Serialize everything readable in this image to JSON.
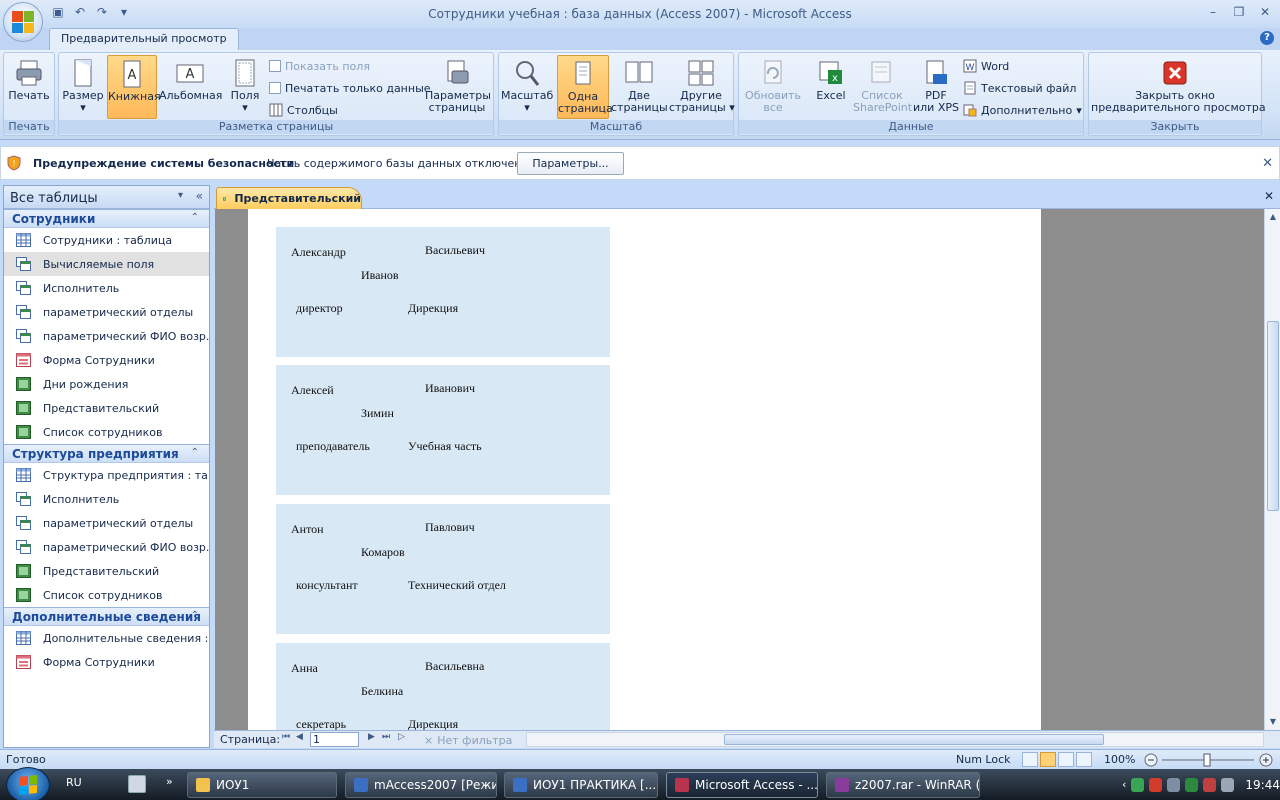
{
  "window": {
    "title": "Сотрудники учебная : база данных (Access 2007) - Microsoft Access"
  },
  "tabs": {
    "active": "Предварительный просмотр"
  },
  "ribbon": {
    "groups": {
      "print": "Печать",
      "page_layout": "Разметка страницы",
      "zoom": "Масштаб",
      "data": "Данные",
      "close": "Закрыть"
    },
    "print_label": "Печать",
    "size_label": "Размер",
    "portrait_label": "Книжная",
    "landscape_label": "Альбомная",
    "margins_label": "Поля",
    "show_margins": "Показать поля",
    "print_data_only": "Печатать только данные",
    "columns": "Столбцы",
    "page_setup_1": "Параметры",
    "page_setup_2": "страницы",
    "zoom_label": "Масштаб",
    "one_page_1": "Одна",
    "one_page_2": "страница",
    "two_pages_1": "Две",
    "two_pages_2": "страницы",
    "more_pages_1": "Другие",
    "more_pages_2": "страницы",
    "refresh_1": "Обновить",
    "refresh_2": "все",
    "excel": "Excel",
    "sharepoint_1": "Список",
    "sharepoint_2": "SharePoint",
    "pdf_1": "PDF",
    "pdf_2": "или XPS",
    "word": "Word",
    "text_file": "Текстовый файл",
    "more": "Дополнительно",
    "close_preview_1": "Закрыть окно",
    "close_preview_2": "предварительного просмотра"
  },
  "security": {
    "title": "Предупреждение системы безопасности",
    "message": "Часть содержимого базы данных отключено",
    "button": "Параметры..."
  },
  "nav": {
    "header": "Все таблицы",
    "groups": [
      {
        "label": "Сотрудники",
        "items": [
          {
            "label": "Сотрудники : таблица",
            "icon": "table-icon"
          },
          {
            "label": "Вычисляемые поля",
            "icon": "query-icon",
            "selected": true
          },
          {
            "label": "Исполнитель",
            "icon": "query-icon"
          },
          {
            "label": "параметрический отделы",
            "icon": "query-icon"
          },
          {
            "label": "параметрический ФИО возр...",
            "icon": "query-icon"
          },
          {
            "label": "Форма Сотрудники",
            "icon": "form-icon"
          },
          {
            "label": "Дни рождения",
            "icon": "report-icon"
          },
          {
            "label": "Представительский",
            "icon": "report-icon"
          },
          {
            "label": "Список сотрудников",
            "icon": "report-icon"
          }
        ]
      },
      {
        "label": "Структура предприятия",
        "items": [
          {
            "label": "Структура предприятия : та...",
            "icon": "table-icon"
          },
          {
            "label": "Исполнитель",
            "icon": "query-icon"
          },
          {
            "label": "параметрический отделы",
            "icon": "query-icon"
          },
          {
            "label": "параметрический ФИО возр...",
            "icon": "query-icon"
          },
          {
            "label": "Представительский",
            "icon": "report-icon"
          },
          {
            "label": "Список сотрудников",
            "icon": "report-icon"
          }
        ]
      },
      {
        "label": "Дополнительные сведения",
        "items": [
          {
            "label": "Дополнительные сведения :...",
            "icon": "table-icon"
          },
          {
            "label": "Форма Сотрудники",
            "icon": "form-icon"
          }
        ]
      }
    ]
  },
  "document": {
    "tab": "Представительский",
    "cards": [
      {
        "first": "Александр",
        "patronymic": "Васильевич",
        "last": "Иванов",
        "position": "директор",
        "dept": "Дирекция"
      },
      {
        "first": "Алексей",
        "patronymic": "Иванович",
        "last": "Зимин",
        "position": "преподаватель",
        "dept": "Учебная часть"
      },
      {
        "first": "Антон",
        "patronymic": "Павлович",
        "last": "Комаров",
        "position": "консультант",
        "dept": "Технический отдел"
      },
      {
        "first": "Анна",
        "patronymic": "Васильевна",
        "last": "Белкина",
        "position": "секретарь",
        "dept": "Дирекция"
      }
    ]
  },
  "record_nav": {
    "label": "Страница:",
    "page": "1",
    "filter": "Нет фильтра"
  },
  "status": {
    "left": "Готово",
    "numlock": "Num Lock",
    "zoom": "100%"
  },
  "taskbar": {
    "lang": "RU",
    "more": "»",
    "buttons": [
      {
        "label": "ИОУ1",
        "color": "#f2c14e"
      },
      {
        "label": "mAccess2007 [Режи...",
        "color": "#3b6fc4"
      },
      {
        "label": "ИОУ1 ПРАКТИКА [...",
        "color": "#3b6fc4"
      },
      {
        "label": "Microsoft Access - ...",
        "color": "#b8344c",
        "active": true
      },
      {
        "label": "z2007.rar - WinRAR (...",
        "color": "#8a3c9c"
      }
    ],
    "clock": "19:44"
  }
}
